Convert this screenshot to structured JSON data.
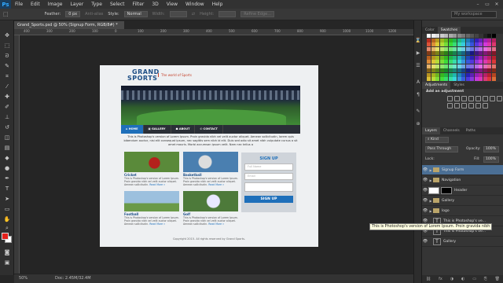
{
  "menubar": {
    "logo": "Ps",
    "items": [
      "File",
      "Edit",
      "Image",
      "Layer",
      "Type",
      "Select",
      "Filter",
      "3D",
      "View",
      "Window",
      "Help"
    ],
    "controls": [
      "–",
      "▭",
      "✕"
    ]
  },
  "options": {
    "feather_label": "Feather:",
    "feather_value": "0 px",
    "antialias": "Anti-alias",
    "style_label": "Style:",
    "style_value": "Normal",
    "width_label": "Width:",
    "height_label": "Height:",
    "refine": "Refine Edge...",
    "workspace": "My workspace"
  },
  "document": {
    "tab": "Grand_Sports.psd @ 50% (Signup Form, RGB/8#) *",
    "ruler_numbers": [
      "400",
      "300",
      "200",
      "100",
      "0",
      "100",
      "200",
      "300",
      "400",
      "500",
      "600",
      "700",
      "800",
      "900",
      "1000",
      "1100",
      "1200"
    ]
  },
  "site": {
    "logo_line1": "GRAND",
    "logo_line2": "SPORTS",
    "tagline": "The world of Sports",
    "nav": [
      "HOME",
      "GALLERY",
      "ABOUT",
      "CONTACT"
    ],
    "intro": "This is Photoshop's version of Lorem Ipsum. Proin gravida nibh vel velit auctor aliquet. Aenean sollicitudin, lorem quis bibendum auctor, nisi elit consequat ipsum, nec sagittis sem nibh id elit. Duis sed odio sit amet nibh vulputate cursus a sit amet mauris. Morbi accumsan ipsum velit. Nam nec tellus a",
    "cards": [
      {
        "title": "Cricket",
        "text": "This is Photoshop's version of Lorem Ipsum. Proin gravida nibh vel velit auctor aliquet. Aenean sollicitudin.",
        "more": "Read More »",
        "color": "#5a8a3a"
      },
      {
        "title": "Basketball",
        "text": "This is Photoshop's version of Lorem Ipsum. Proin gravida nibh vel velit auctor aliquet. Aenean sollicitudin.",
        "more": "Read More »",
        "color": "#4a7fb0"
      },
      {
        "title": "Football",
        "text": "This is Photoshop's version of Lorem Ipsum. Proin gravida nibh vel velit auctor aliquet. Aenean sollicitudin.",
        "more": "Read More »",
        "color": "#6f9ec8"
      },
      {
        "title": "Golf",
        "text": "This is Photoshop's version of Lorem Ipsum. Proin gravida nibh vel velit auctor aliquet. Aenean sollicitudin.",
        "more": "Read More »",
        "color": "#4d7a3a"
      }
    ],
    "signup": {
      "title": "SIGN UP",
      "name_placeholder": "Full Name",
      "email_placeholder": "Email",
      "button": "SIGN UP"
    },
    "footer": "Copyright 2015. All rights reserved by Grand Sports."
  },
  "statusbar": {
    "zoom": "50%",
    "doc": "Doc: 2.45M/32.4M"
  },
  "panels": {
    "top_tabs": [
      "Color",
      "Swatches"
    ],
    "adj_tabs": [
      "Adjustments",
      "Styles"
    ],
    "adj_label": "Add an adjustment",
    "layer_tabs": [
      "Layers",
      "Channels",
      "Paths"
    ],
    "kind": "Kind",
    "blend": "Pass Through",
    "opacity_label": "Opacity:",
    "opacity": "100%",
    "lock_label": "Lock:",
    "fill_label": "Fill:",
    "fill": "100%",
    "layers": [
      {
        "name": "Signup Form",
        "type": "folder",
        "selected": true
      },
      {
        "name": "Navigation",
        "type": "folder",
        "selected": false
      },
      {
        "name": "Header",
        "type": "image",
        "selected": false
      },
      {
        "name": "Gallery",
        "type": "folder",
        "selected": false
      },
      {
        "name": "logo",
        "type": "folder",
        "selected": false
      },
      {
        "name": "This is Photoshop's ve...",
        "type": "text",
        "selected": false
      },
      {
        "name": "This is Photoshop's ve...",
        "type": "text",
        "selected": false
      },
      {
        "name": "Gallery",
        "type": "text",
        "selected": false
      }
    ],
    "footer_icons": [
      "⛓",
      "fx",
      "◑",
      "◐",
      "▭",
      "⎘",
      "🗑"
    ]
  },
  "tooltip": "This is Photoshop's version  of Lorem Ipsum. Proin gravida nibh",
  "accent": "#1e6fba"
}
